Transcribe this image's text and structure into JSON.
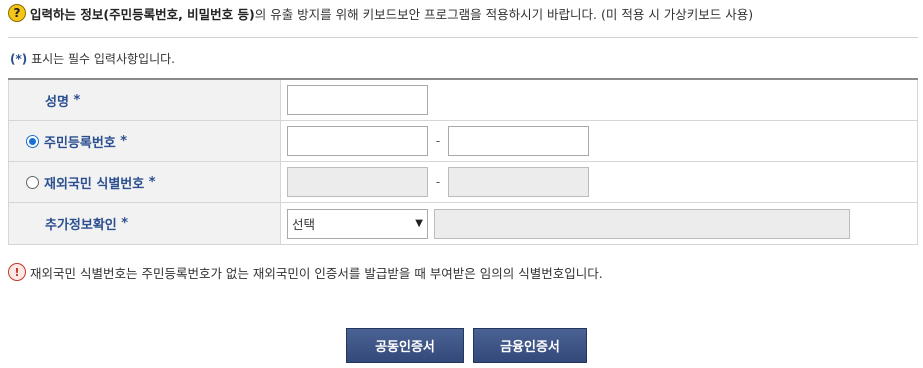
{
  "notice": {
    "icon": "question-icon",
    "bold_text": "입력하는 정보(주민등록번호, 비밀번호 등)",
    "rest_text": "의 유출 방지를 위해 키보드보안 프로그램을 적용하시기 바랍니다. (미 적용 시 가상키보드 사용)"
  },
  "required_note": {
    "star": "(*)",
    "text": " 표시는 필수 입력사항입니다."
  },
  "form": {
    "name_label": "성명",
    "rrn_label": "주민등록번호",
    "foreigner_label": "재외국민 식별번호",
    "extra_label": "추가정보확인",
    "required_mark": "*",
    "dash": "-",
    "name_value": "",
    "rrn_front": "",
    "rrn_back": "",
    "foreign_front": "",
    "foreign_back": "",
    "extra_select_value": "선택",
    "extra_input_value": "",
    "selected_id_type": "rrn"
  },
  "info_note": {
    "icon": "exclamation-icon",
    "text": "재외국민 식별번호는 주민등록번호가 없는 재외국민이 인증서를 발급받을 때 부여받은 임의의 식별번호입니다."
  },
  "buttons": {
    "joint_cert": "공동인증서",
    "financial_cert": "금융인증서"
  },
  "colors": {
    "label_blue": "#2b4f8f",
    "button_bg": "#3f578a",
    "radio_checked": "#1a6fd1",
    "warning_red": "#c0392b",
    "question_yellow": "#f5c518"
  }
}
